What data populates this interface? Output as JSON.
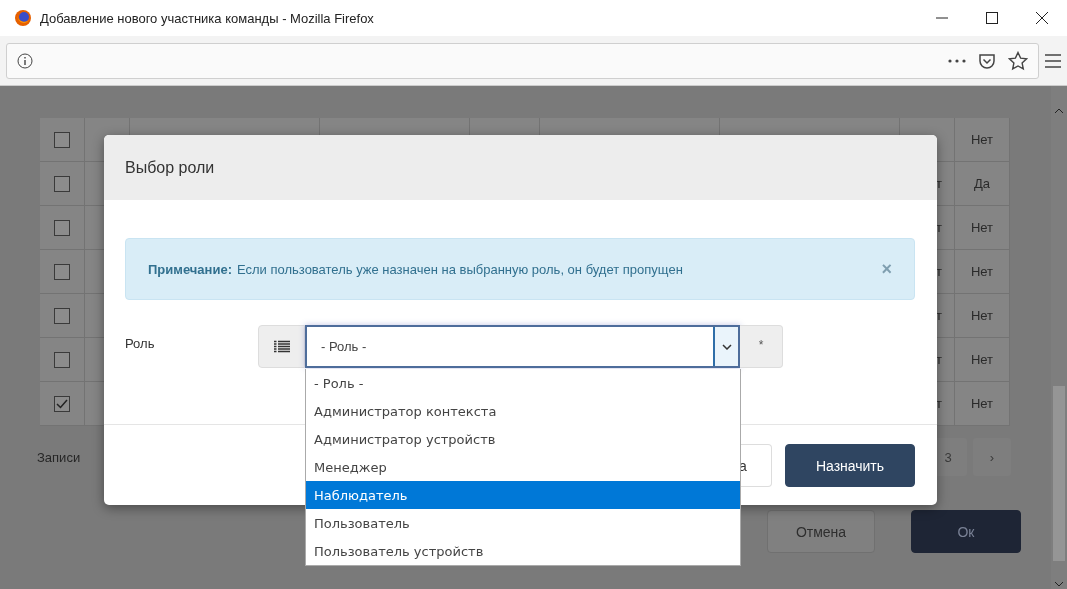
{
  "window": {
    "title": "Добавление нового участника команды - Mozilla Firefox"
  },
  "table": {
    "rows": [
      {
        "checked": false,
        "col_b": "Нет"
      },
      {
        "checked": false,
        "col_a": "т",
        "col_b": "Да"
      },
      {
        "checked": false,
        "col_a": "т",
        "col_b": "Нет"
      },
      {
        "checked": false,
        "col_a": "т",
        "col_b": "Нет"
      },
      {
        "checked": false,
        "col_a": "т",
        "col_b": "Нет"
      },
      {
        "checked": false,
        "col_a": "т",
        "col_b": "Нет"
      },
      {
        "checked": true,
        "col_a": "т",
        "col_b": "Нет"
      }
    ]
  },
  "pagination": {
    "label": "Записи",
    "pages": [
      "3"
    ],
    "next": "›"
  },
  "footer_buttons": [
    {
      "label": "Отмена",
      "kind": "secondary"
    },
    {
      "label": "Ок",
      "kind": "primary"
    }
  ],
  "dialog": {
    "title": "Выбор роли",
    "alert": {
      "label": "Примечание:",
      "text": "Если пользователь уже назначен на выбранную роль, он будет пропущен",
      "close": "×"
    },
    "field": {
      "label": "Роль",
      "value": "- Роль -",
      "required": "*"
    },
    "options": [
      {
        "label": "- Роль -",
        "selected": false
      },
      {
        "label": "Администратор контекста",
        "selected": false
      },
      {
        "label": "Администратор устройств",
        "selected": false
      },
      {
        "label": "Менеджер",
        "selected": false
      },
      {
        "label": "Наблюдатель",
        "selected": true
      },
      {
        "label": "Пользователь",
        "selected": false
      },
      {
        "label": "Пользователь устройств",
        "selected": false
      }
    ],
    "buttons": [
      {
        "label": "а",
        "kind": "secondary"
      },
      {
        "label": "Назначить",
        "kind": "primary"
      }
    ]
  }
}
